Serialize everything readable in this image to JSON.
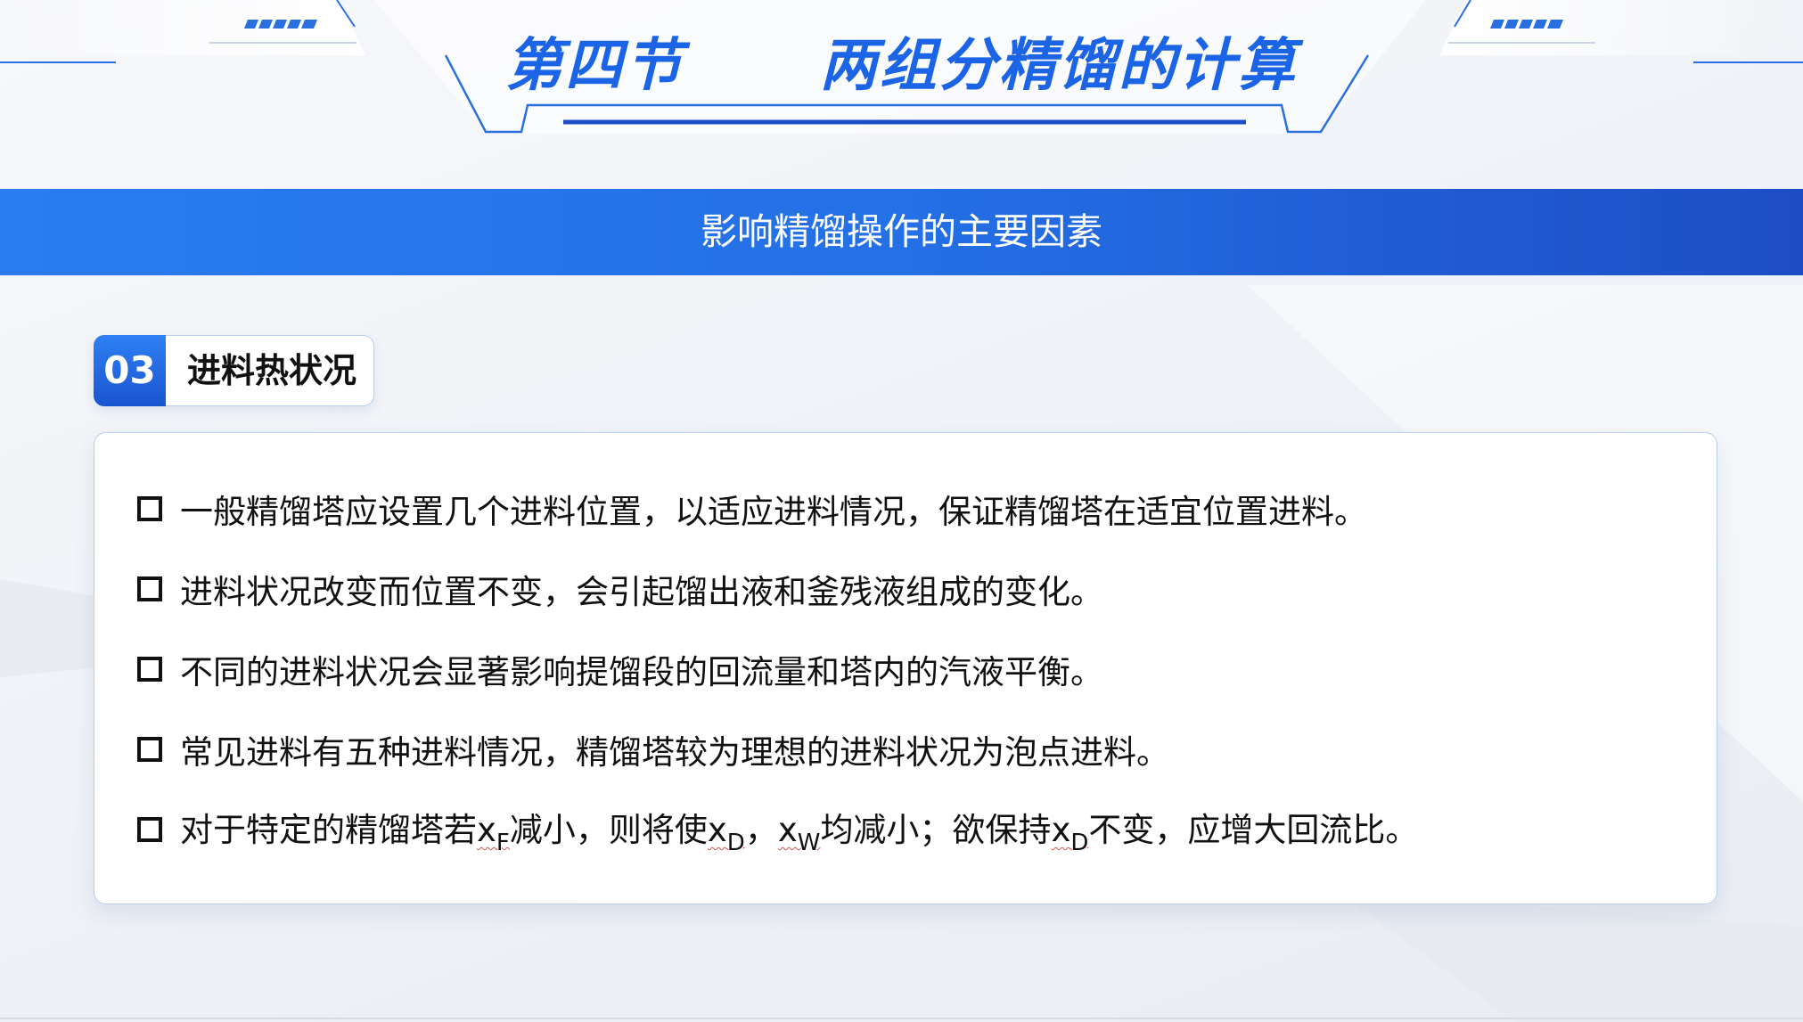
{
  "header": {
    "title_part1": "第四节",
    "title_part2": "两组分精馏的计算"
  },
  "banner": {
    "text": "影响精馏操作的主要因素"
  },
  "section": {
    "number": "03",
    "label": "进料热状况"
  },
  "bullets": [
    "一般精馏塔应设置几个进料位置，以适应进料情况，保证精馏塔在适宜位置进料。",
    "进料状况改变而位置不变，会引起馏出液和釜残液组成的变化。",
    "不同的进料状况会显著影响提馏段的回流量和塔内的汽液平衡。",
    "常见进料有五种进料情况，精馏塔较为理想的进料状况为泡点进料。"
  ],
  "bullet5": {
    "p1": "对于特定的精馏塔若",
    "xF_base": "x",
    "xF_sub": "F",
    "p2": "减小，则将使",
    "xD_base": "x",
    "xD_sub": "D",
    "p3": "，",
    "xW_base": "x",
    "xW_sub": "W",
    "p4": "均减小；欲保持",
    "xD2_base": "x",
    "xD2_sub": "D",
    "p5": "不变，应增大回流比。"
  },
  "colors": {
    "accent": "#1c64e6",
    "banner_start": "#2a7cf0",
    "banner_end": "#1d4dc6",
    "text": "#111111"
  }
}
